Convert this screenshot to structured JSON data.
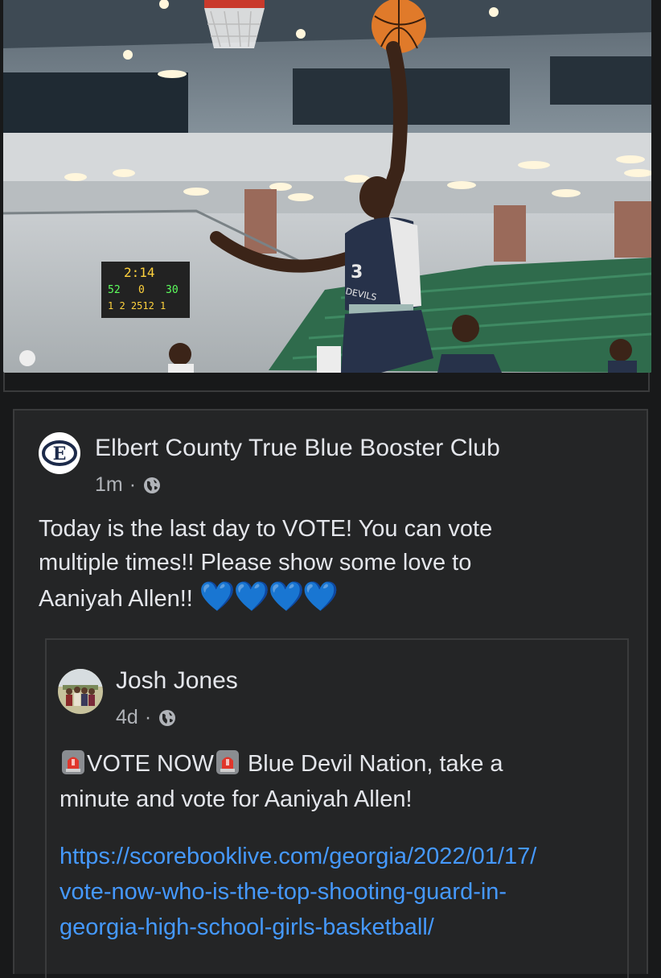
{
  "photo": {
    "jersey_number": "3",
    "jersey_text": "DEVILS",
    "scoreboard_top": "2:14",
    "scoreboard_row1_left": "52",
    "scoreboard_row1_mid": "0",
    "scoreboard_row1_right": "30",
    "scoreboard_row2": "1 2 2512 1"
  },
  "post": {
    "author": "Elbert County True Blue Booster Club",
    "time": "1m",
    "text_line1": "Today is the last day to VOTE! You can vote",
    "text_line2": "multiple times!! Please show some love to",
    "text_line3": "Aaniyah Allen!!",
    "hearts": "💙💙💙💙",
    "avatar_letter": "E"
  },
  "shared": {
    "author": "Josh Jones",
    "time": "4d",
    "line1_a": "VOTE NOW",
    "line1_b": " Blue Devil Nation, take a",
    "line2": "minute and vote for Aaniyah Allen!",
    "link_line1": "https://scorebooklive.com/georgia/2022/01/17/",
    "link_line2": "vote-now-who-is-the-top-shooting-guard-in-",
    "link_line3": "georgia-high-school-girls-basketball/"
  },
  "colors": {
    "background": "#18191a",
    "link": "#4599ff",
    "heart": "#2d88ff",
    "secondary_text": "#b0b3b8"
  }
}
